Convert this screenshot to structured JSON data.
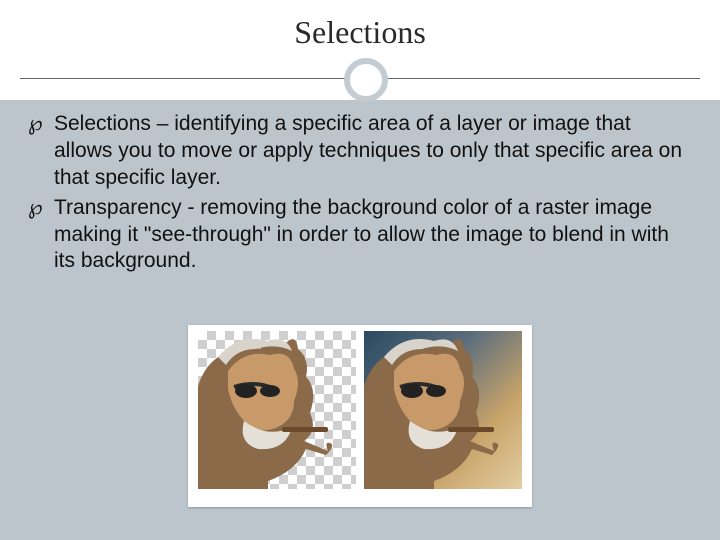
{
  "title": "Selections",
  "bullets": [
    "Selections – identifying a specific area of a layer or image that allows you to move or apply techniques to only that specific area on that specific layer.",
    "Transparency - removing the background color of a raster image making it \"see-through\" in order to allow the image to blend in with its background."
  ],
  "image": {
    "left_alt": "portrait on transparency checker background",
    "right_alt": "portrait blended onto sky background"
  }
}
